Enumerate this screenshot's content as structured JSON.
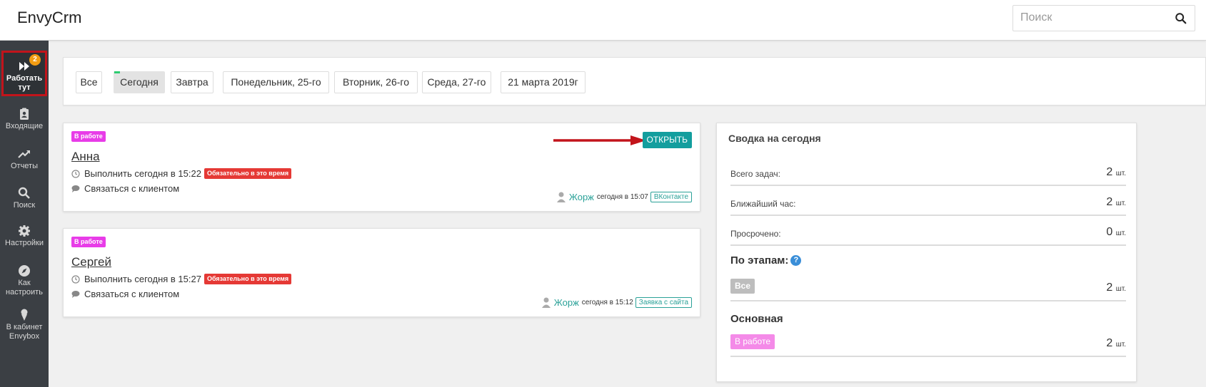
{
  "app": {
    "title": "EnvyCrm"
  },
  "search": {
    "placeholder": "Поиск",
    "value": ""
  },
  "sidebar": {
    "items": [
      {
        "label": "Работать тут",
        "badge": "2"
      },
      {
        "label": "Входящие"
      },
      {
        "label": "Отчеты"
      },
      {
        "label": "Поиск"
      },
      {
        "label": "Настройки"
      },
      {
        "label": "Как настроить"
      },
      {
        "label": "В кабинет Envybox"
      }
    ]
  },
  "filters": {
    "active": "Сегодня",
    "items": [
      "Все",
      "Сегодня",
      "Завтра",
      "Понедельник, 25-го",
      "Вторник, 26-го",
      "Среда, 27-го",
      "21 марта 2019г"
    ]
  },
  "tasks": [
    {
      "status": "В работе",
      "client": "Анна",
      "due": "Выполнить сегодня в 15:22",
      "required_tag": "Обязательно в это время",
      "action": "Связаться с клиентом",
      "user": "Жорж",
      "time": "сегодня в 15:07",
      "source": "ВКонтакте",
      "open_label": "ОТКРЫТЬ"
    },
    {
      "status": "В работе",
      "client": "Сергей",
      "due": "Выполнить сегодня в 15:27",
      "required_tag": "Обязательно в это время",
      "action": "Связаться с клиентом",
      "user": "Жорж",
      "time": "сегодня в 15:12",
      "source": "Заявка с сайта"
    }
  ],
  "summary": {
    "title": "Сводка на сегодня",
    "rows": [
      {
        "label": "Всего задач:",
        "value": "2",
        "unit": "шт."
      },
      {
        "label": "Ближайший час:",
        "value": "2",
        "unit": "шт."
      },
      {
        "label": "Просрочено:",
        "value": "0",
        "unit": "шт."
      }
    ],
    "stages_heading": "По этапам:",
    "stages_all": {
      "label": "Все",
      "value": "2",
      "unit": "шт."
    },
    "pipeline_heading": "Основная",
    "pipeline_stage": {
      "label": "В работе",
      "value": "2",
      "unit": "шт."
    }
  },
  "colors": {
    "accent": "#139e9e",
    "status_pink": "#e83ce8",
    "required_red": "#e53935",
    "sidebar_bg": "#3b3f44",
    "badge_orange": "#f39c12"
  }
}
